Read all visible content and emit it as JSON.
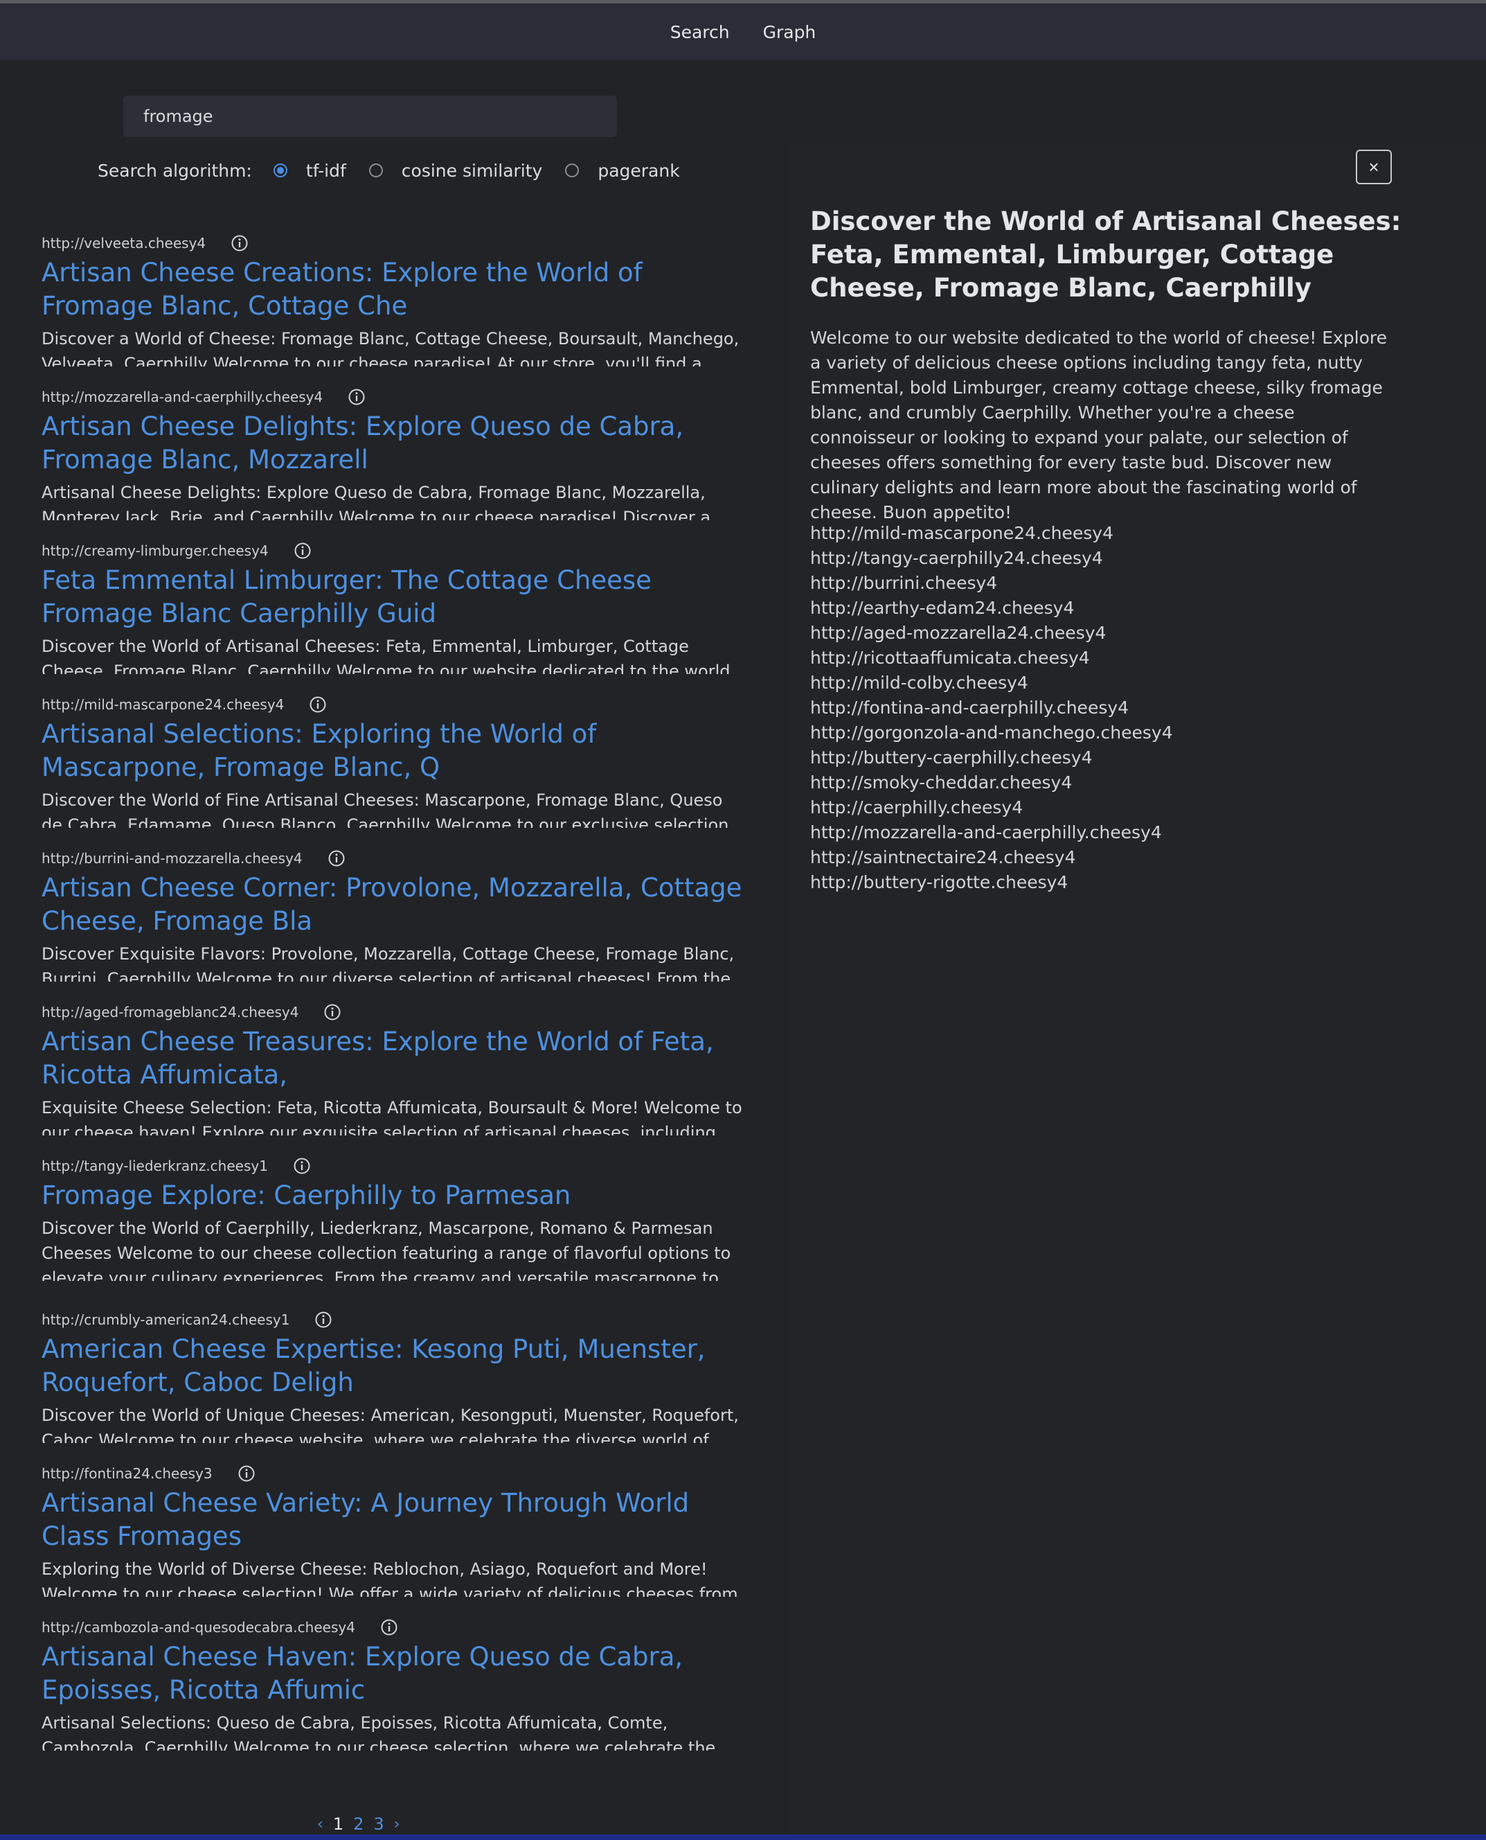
{
  "nav": {
    "search_label": "Search",
    "graph_label": "Graph"
  },
  "search": {
    "value": "fromage"
  },
  "algorithm": {
    "label": "Search algorithm:",
    "options": [
      "tf-idf",
      "cosine similarity",
      "pagerank"
    ],
    "selected": "tf-idf"
  },
  "results": [
    {
      "url": "http://velveeta.cheesy4",
      "title": "Artisan Cheese Creations: Explore the World of Fromage Blanc, Cottage Che",
      "snippet": "Discover a World of Cheese: Fromage Blanc, Cottage Cheese, Boursault, Manchego, Velveeta, Caerphilly Welcome to our cheese paradise! At our store, you'll find a delightful"
    },
    {
      "url": "http://mozzarella-and-caerphilly.cheesy4",
      "title": "Artisan Cheese Delights: Explore Queso de Cabra, Fromage Blanc, Mozzarell",
      "snippet": "Artisanal Cheese Delights: Explore Queso de Cabra, Fromage Blanc, Mozzarella, Monterey Jack, Brie, and Caerphilly Welcome to our cheese paradise! Discover a world of unique"
    },
    {
      "url": "http://creamy-limburger.cheesy4",
      "title": "Feta Emmental Limburger: The Cottage Cheese Fromage Blanc Caerphilly Guid",
      "snippet": "Discover the World of Artisanal Cheeses: Feta, Emmental, Limburger, Cottage Cheese, Fromage Blanc, Caerphilly Welcome to our website dedicated to the world of cheese!"
    },
    {
      "url": "http://mild-mascarpone24.cheesy4",
      "title": "Artisanal Selections: Exploring the World of Mascarpone, Fromage Blanc, Q",
      "snippet": "Discover the World of Fine Artisanal Cheeses: Mascarpone, Fromage Blanc, Queso de Cabra, Edamame, Queso Blanco, Caerphilly Welcome to our exclusive selection of"
    },
    {
      "url": "http://burrini-and-mozzarella.cheesy4",
      "title": "Artisan Cheese Corner: Provolone, Mozzarella, Cottage Cheese, Fromage Bla",
      "snippet": "Discover Exquisite Flavors: Provolone, Mozzarella, Cottage Cheese, Fromage Blanc, Burrini, Caerphilly Welcome to our diverse selection of artisanal cheeses! From the"
    },
    {
      "url": "http://aged-fromageblanc24.cheesy4",
      "title": "Artisan Cheese Treasures: Explore the World of Feta, Ricotta Affumicata,",
      "snippet": "Exquisite Cheese Selection: Feta, Ricotta Affumicata, Boursault & More! Welcome to our cheese haven! Explore our exquisite selection of artisanal cheeses, including feta, ricotta"
    },
    {
      "url": "http://tangy-liederkranz.cheesy1",
      "title": "Fromage Explore: Caerphilly to Parmesan",
      "snippet": "Discover the World of Caerphilly, Liederkranz, Mascarpone, Romano & Parmesan Cheeses Welcome to our cheese collection featuring a range of flavorful options to elevate your culinary experiences. From the creamy and versatile mascarpone to the sharp and tangy"
    },
    {
      "url": "http://crumbly-american24.cheesy1",
      "title": "American Cheese Expertise: Kesong Puti, Muenster, Roquefort, Caboc Deligh",
      "snippet": "Discover the World of Unique Cheeses: American, Kesongputi, Muenster, Roquefort, Caboc Welcome to our cheese website, where we celebrate the diverse world of cheese"
    },
    {
      "url": "http://fontina24.cheesy3",
      "title": "Artisanal Cheese Variety: A Journey Through World Class Fromages",
      "snippet": "Exploring the World of Diverse Cheese: Reblochon, Asiago, Roquefort and More! Welcome to our cheese selection! We offer a wide variety of delicious cheeses from"
    },
    {
      "url": "http://cambozola-and-quesodecabra.cheesy4",
      "title": "Artisanal Cheese Haven: Explore Queso de Cabra, Epoisses, Ricotta Affumic",
      "snippet": "Artisanal Selections: Queso de Cabra, Epoisses, Ricotta Affumicata, Comte, Cambozola, Caerphilly Welcome to our cheese selection, where we celebrate the finest fromage from"
    }
  ],
  "pagination": {
    "prev": "‹",
    "pages": [
      "1",
      "2",
      "3"
    ],
    "current": "1",
    "next": "›"
  },
  "detail": {
    "close_label": "×",
    "title": "Discover the World of Artisanal Cheeses: Feta, Emmental, Limburger, Cottage Cheese, Fromage Blanc, Caerphilly",
    "description": "Welcome to our website dedicated to the world of cheese! Explore a variety of delicious cheese options including tangy feta, nutty Emmental, bold Limburger, creamy cottage cheese, silky fromage blanc, and crumbly Caerphilly. Whether you're a cheese connoisseur or looking to expand your palate, our selection of cheeses offers something for every taste bud. Discover new culinary delights and learn more about the fascinating world of cheese. Buon appetito!",
    "links": [
      "http://mild-mascarpone24.cheesy4",
      "http://tangy-caerphilly24.cheesy4",
      "http://burrini.cheesy4",
      "http://earthy-edam24.cheesy4",
      "http://aged-mozzarella24.cheesy4",
      "http://ricottaaffumicata.cheesy4",
      "http://mild-colby.cheesy4",
      "http://fontina-and-caerphilly.cheesy4",
      "http://gorgonzola-and-manchego.cheesy4",
      "http://buttery-caerphilly.cheesy4",
      "http://smoky-cheddar.cheesy4",
      "http://caerphilly.cheesy4",
      "http://mozzarella-and-caerphilly.cheesy4",
      "http://saintnectaire24.cheesy4",
      "http://buttery-rigotte.cheesy4"
    ]
  },
  "colors": {
    "accent": "#4d90e0",
    "background": "#222326",
    "topbar": "#2b2c37"
  }
}
